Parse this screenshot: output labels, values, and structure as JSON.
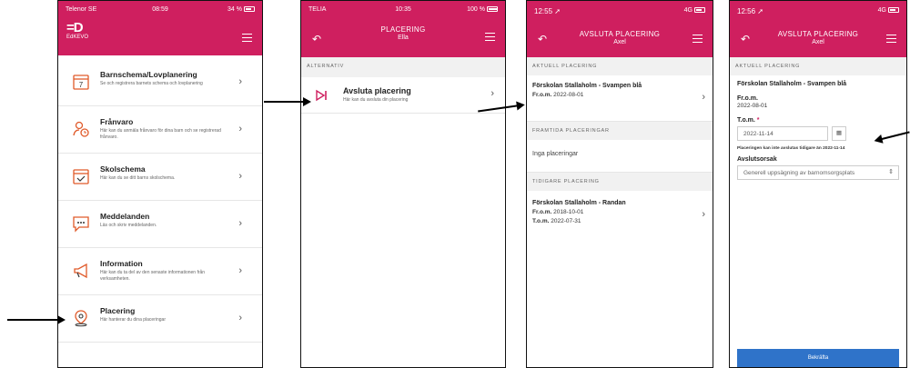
{
  "phone1": {
    "status": {
      "carrier": "Telenor SE",
      "time": "08:59",
      "battery": "34 %"
    },
    "logo_text": "EdKEVO",
    "items": [
      {
        "title": "Barnschema/Lovplanering",
        "desc": "Se och registrera barnets schema och lovplanering"
      },
      {
        "title": "Frånvaro",
        "desc": "Här kan du anmäla frånvaro för dina barn och se registrerad frånvaro."
      },
      {
        "title": "Skolschema",
        "desc": "Här kan du se ditt barns skolschema."
      },
      {
        "title": "Meddelanden",
        "desc": "Läs och skriv meddelanden."
      },
      {
        "title": "Information",
        "desc": "Här kan du ta del av den senaste informationen från verksamheten."
      },
      {
        "title": "Placering",
        "desc": "Här hanterar du dina placeringar"
      }
    ]
  },
  "phone2": {
    "status": {
      "carrier": "TELIA",
      "time": "10:35",
      "battery": "100 %"
    },
    "title": "PLACERING",
    "subtitle": "Ella",
    "section": "ALTERNATIV",
    "item": {
      "title": "Avsluta placering",
      "desc": "Här kan du avsluta din placering"
    }
  },
  "phone3": {
    "status": {
      "time": "12:55",
      "network": "4G"
    },
    "title": "AVSLUTA PLACERING",
    "subtitle": "Axel",
    "sec_current": "AKTUELL PLACERING",
    "current": {
      "name": "Förskolan Stallaholm - Svampen blå",
      "from_label": "Fr.o.m.",
      "from": "2022-08-01"
    },
    "sec_future": "FRAMTIDA PLACERINGAR",
    "future_empty": "Inga placeringar",
    "sec_past": "TIDIGARE PLACERING",
    "past": {
      "name": "Förskolan Stallaholm - Randan",
      "from_label": "Fr.o.m.",
      "from": "2018-10-01",
      "to_label": "T.o.m.",
      "to": "2022-07-31"
    }
  },
  "phone4": {
    "status": {
      "time": "12:56",
      "network": "4G"
    },
    "title": "AVSLUTA PLACERING",
    "subtitle": "Axel",
    "sec_current": "AKTUELL PLACERING",
    "name": "Förskolan Stallaholm - Svampen blå",
    "from_label": "Fr.o.m.",
    "from": "2022-08-01",
    "to_label": "T.o.m.",
    "required": "*",
    "to_value": "2022-11-14",
    "note": "Placeringen kan inte avslutas tidigare än 2022-11-14",
    "reason_label": "Avslutsorsak",
    "reason_value": "Generell uppsägning av barnomsorgsplats",
    "confirm": "Bekräfta"
  },
  "colors": {
    "brand": "#cf1f5f",
    "accent": "#e05a2a",
    "button": "#2f73c9"
  }
}
